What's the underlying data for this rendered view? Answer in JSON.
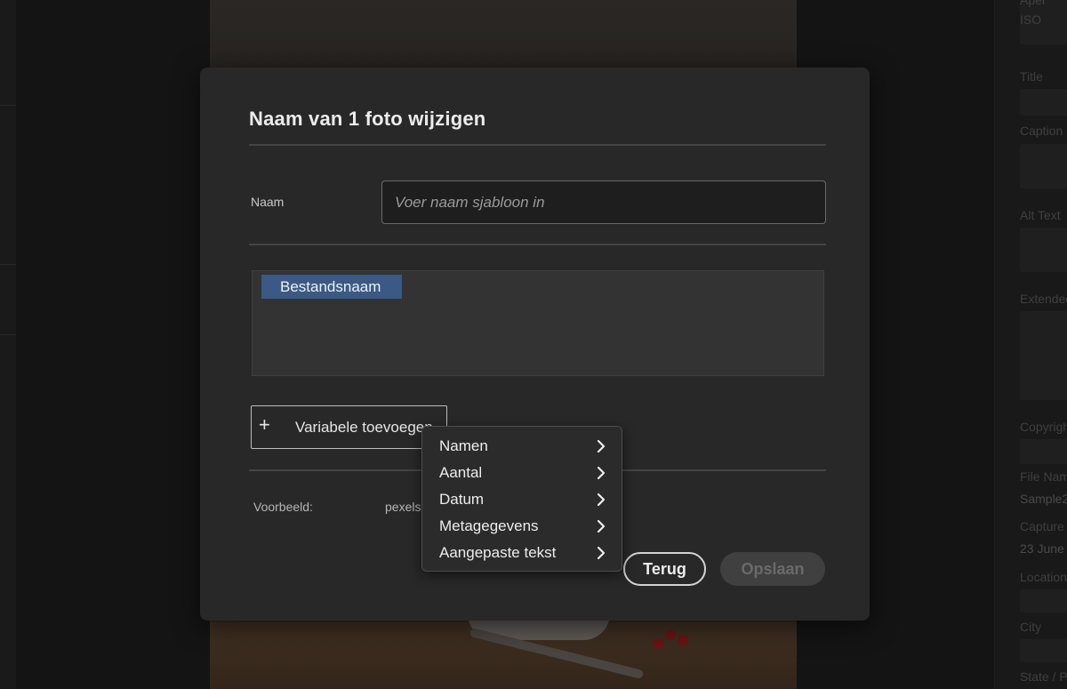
{
  "dialog": {
    "title": "Naam van 1 foto wijzigen",
    "name_label": "Naam",
    "name_placeholder": "Voer naam sjabloon in",
    "token": "Bestandsnaam",
    "add_variable_label": "Variabele toevoegen",
    "preview_label": "Voorbeeld:",
    "preview_value": "pexels",
    "back_label": "Terug",
    "save_label": "Opslaan"
  },
  "menu": {
    "items": [
      {
        "label": "Namen",
        "icon": "chevron-right-icon"
      },
      {
        "label": "Aantal",
        "icon": "chevron-right-icon"
      },
      {
        "label": "Datum",
        "icon": "chevron-right-icon"
      },
      {
        "label": "Metagegevens",
        "icon": "chevron-right-icon"
      },
      {
        "label": "Aangepaste tekst",
        "icon": "chevron-right-icon"
      }
    ]
  },
  "info_panel": {
    "labels": [
      "Aper",
      "ISO",
      "Title",
      "Caption",
      "Alt Text",
      "Extended",
      "Copyright",
      "File Name",
      "Capture",
      "Location",
      "City",
      "State / P"
    ],
    "file_name_value": "Sample2",
    "capture_value": "23 June"
  },
  "colors": {
    "modal_bg": "#282828",
    "token_bg": "#3a5a85",
    "save_disabled_bg": "#404040"
  }
}
